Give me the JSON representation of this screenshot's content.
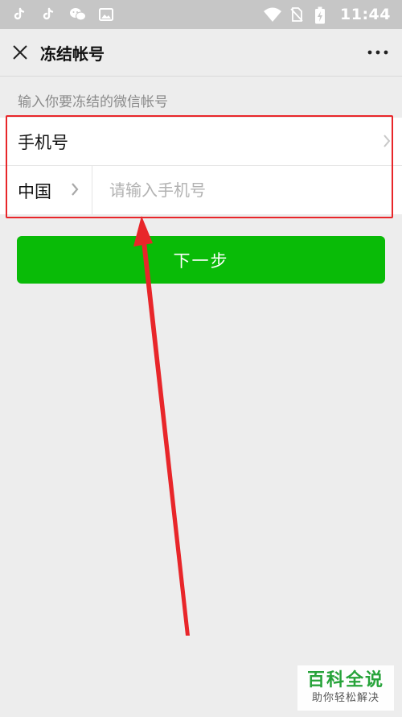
{
  "status_bar": {
    "time": "11:44",
    "left_icons": [
      "tiktok-icon",
      "tiktok-icon",
      "wechat-icon",
      "image-icon"
    ],
    "right_icons": [
      "wifi-icon",
      "no-sim-icon",
      "battery-charging-icon"
    ]
  },
  "header": {
    "title": "冻结帐号"
  },
  "form": {
    "hint": "输入你要冻结的微信帐号",
    "phone_label": "手机号",
    "country": "中国",
    "phone_placeholder": "请输入手机号",
    "phone_value": ""
  },
  "actions": {
    "next_label": "下一步"
  },
  "watermark": {
    "main": "百科全说",
    "sub": "助你轻松解决"
  },
  "colors": {
    "primary_green": "#09bb07",
    "annotation_red": "#e8262a",
    "watermark_green": "#27a33a"
  }
}
